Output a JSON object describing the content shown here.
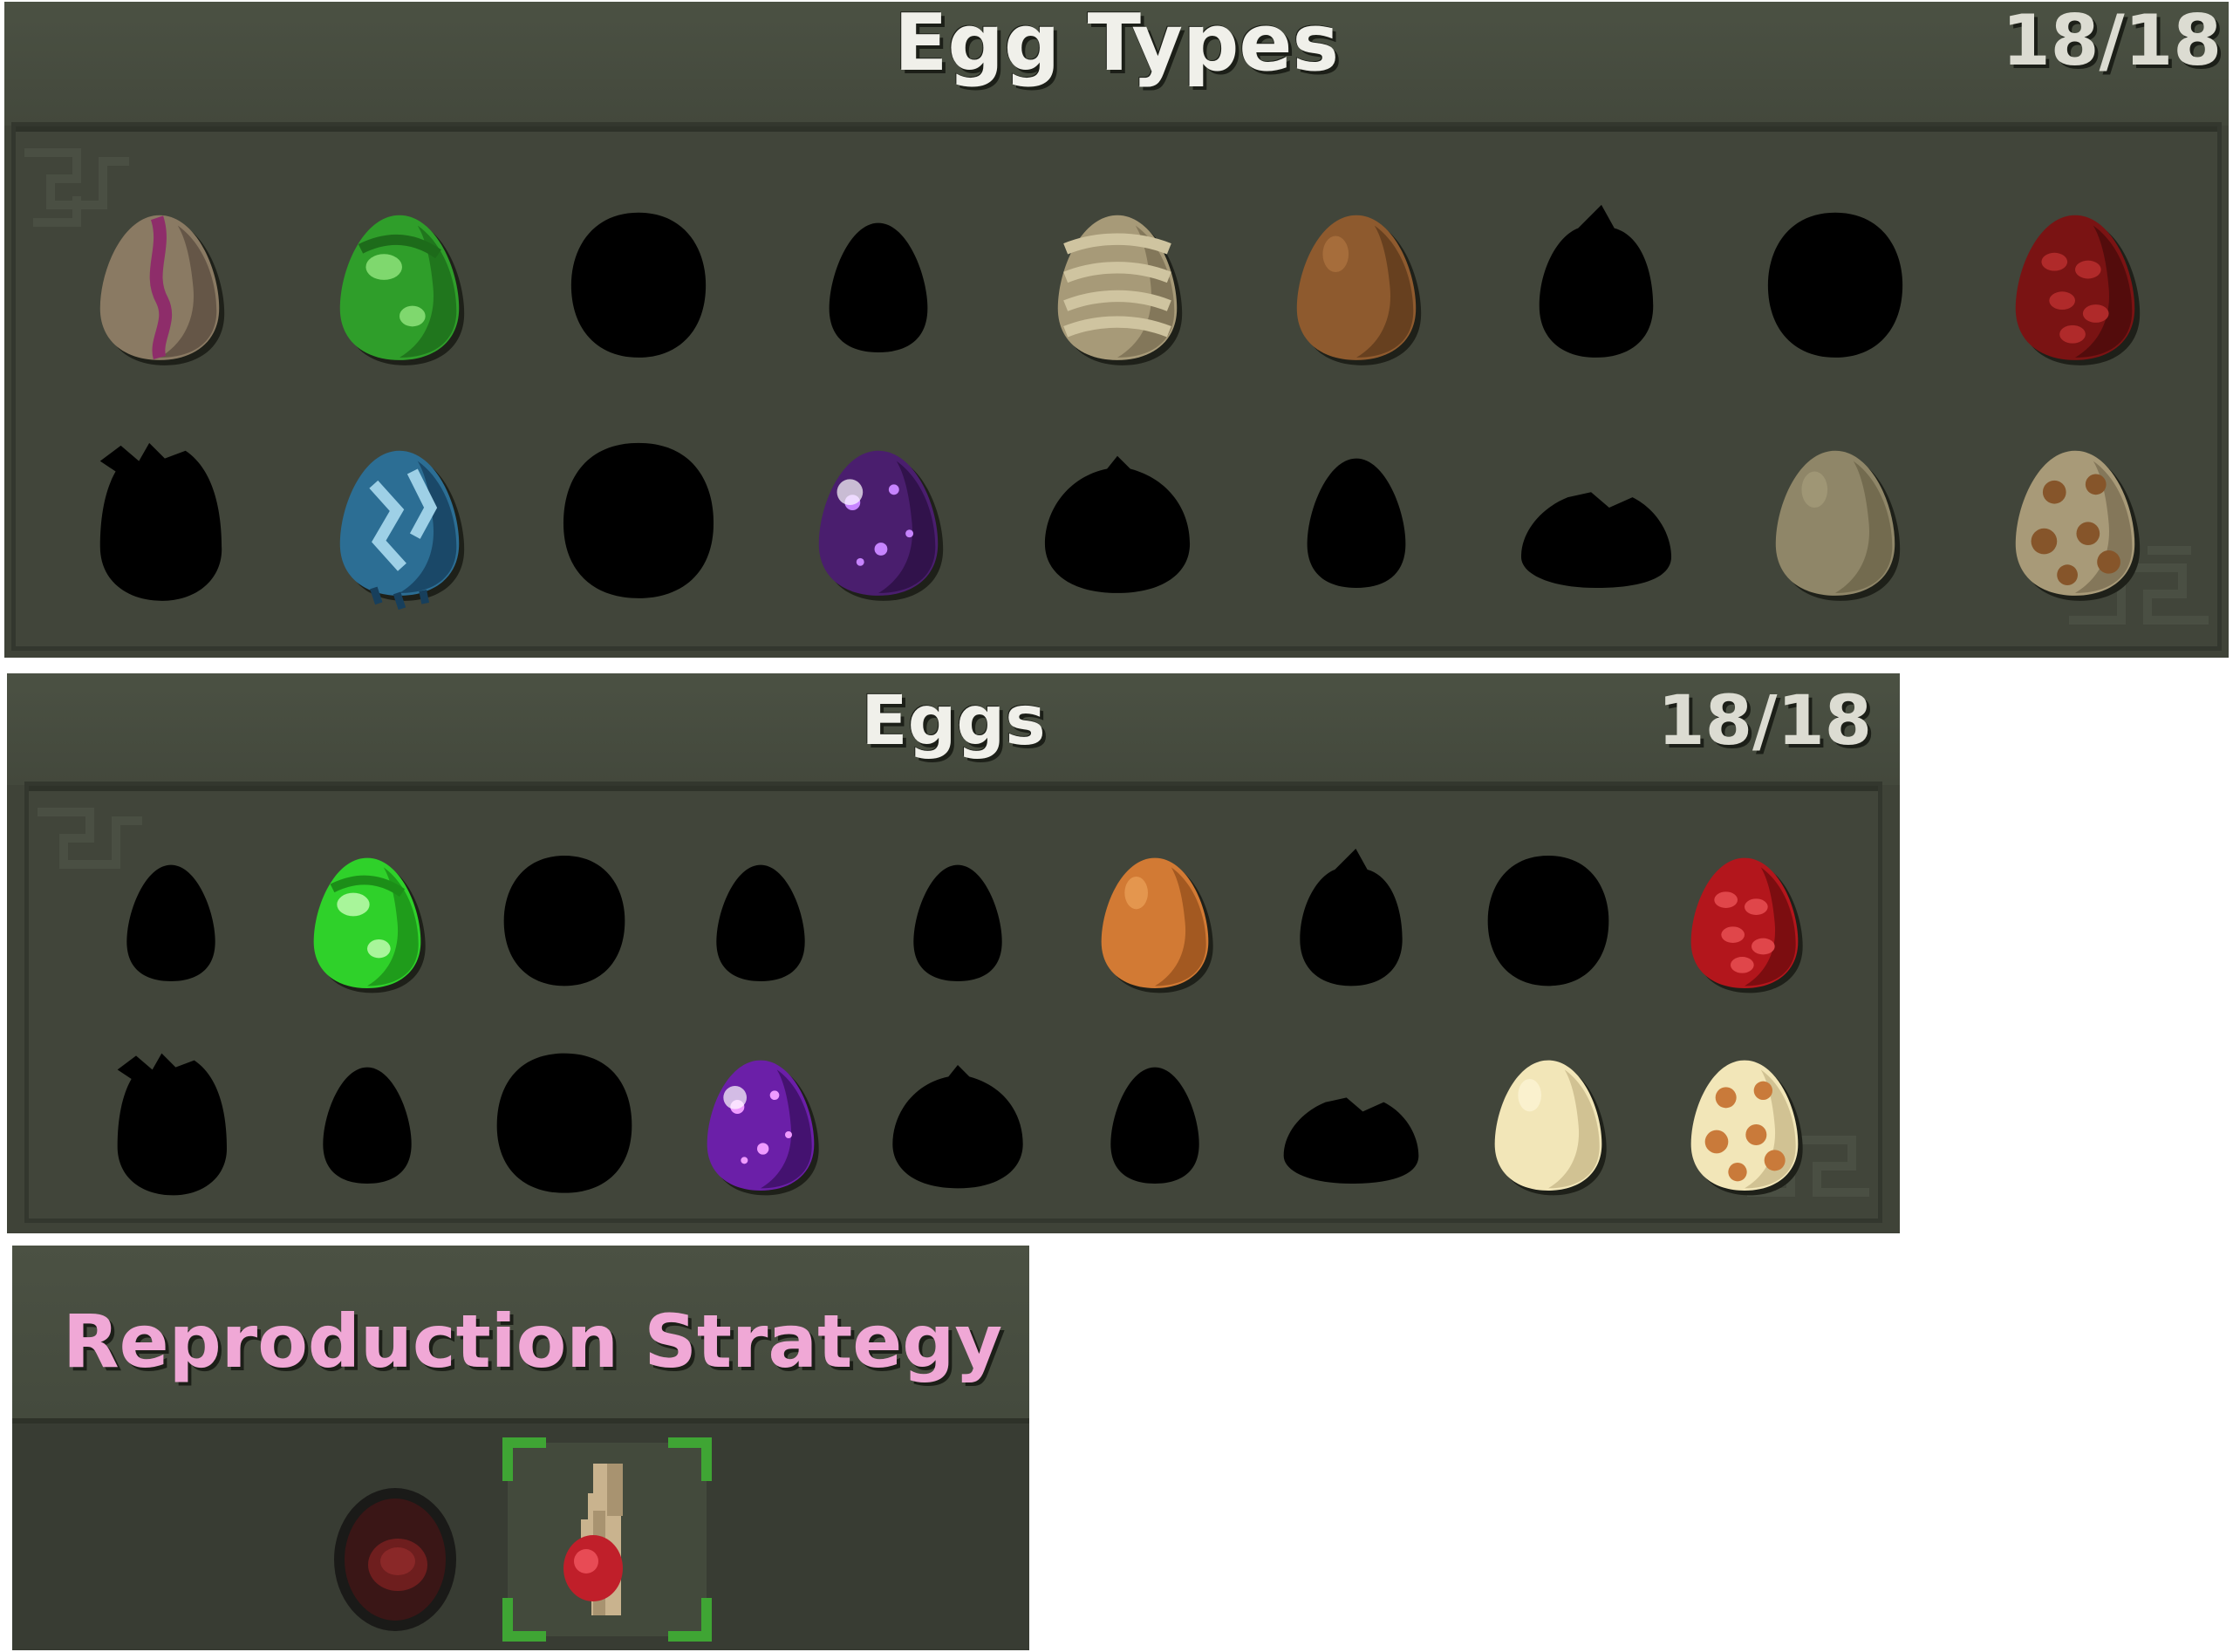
{
  "egg_types": {
    "title": "Egg Types",
    "count": "18/18",
    "rows": [
      [
        {
          "name": "purple-vein-egg",
          "base": "#8a7a63",
          "shade": "#5b4e40",
          "accent": "#8e2d6a",
          "pattern": "vein"
        },
        {
          "name": "green-slime-egg",
          "base": "#2f9e2a",
          "shade": "#1d6b1a",
          "accent": "#7fd86e",
          "pattern": "drip"
        },
        {
          "name": "unknown-egg-round",
          "base": "#000000",
          "shape": "round"
        },
        {
          "name": "unknown-egg-small",
          "base": "#000000",
          "shape": "small"
        },
        {
          "name": "tan-striped-egg",
          "base": "#a79a78",
          "shade": "#7a6e52",
          "accent": "#cfc4a0",
          "pattern": "stripes"
        },
        {
          "name": "brown-egg",
          "base": "#8e5a2e",
          "shade": "#5e3a1c",
          "accent": "#b57a44",
          "pattern": "plain"
        },
        {
          "name": "unknown-egg-horned",
          "base": "#000000",
          "shape": "horned"
        },
        {
          "name": "unknown-egg-round-2",
          "base": "#000000",
          "shape": "round"
        },
        {
          "name": "red-scaled-egg",
          "base": "#7a1313",
          "shade": "#4a0b0b",
          "accent": "#b02a2a",
          "pattern": "scales"
        }
      ],
      [
        {
          "name": "unknown-egg-spiky",
          "base": "#000000",
          "shape": "spiky"
        },
        {
          "name": "blue-crystal-egg",
          "base": "#2c6e94",
          "shade": "#173f5c",
          "accent": "#9ed0e6",
          "pattern": "crystal"
        },
        {
          "name": "unknown-egg-big",
          "base": "#000000",
          "shape": "big"
        },
        {
          "name": "purple-cosmic-egg",
          "base": "#4a1e6e",
          "shade": "#2a0f42",
          "accent": "#c784ff",
          "pattern": "cosmic"
        },
        {
          "name": "unknown-egg-wide",
          "base": "#000000",
          "shape": "wide"
        },
        {
          "name": "unknown-egg-small-2",
          "base": "#000000",
          "shape": "small"
        },
        {
          "name": "unknown-egg-flat",
          "base": "#000000",
          "shape": "flat"
        },
        {
          "name": "beige-plain-egg",
          "base": "#8f8668",
          "shade": "#6c6448",
          "accent": "#aaa27f",
          "pattern": "plain"
        },
        {
          "name": "beige-spotted-egg",
          "base": "#a89a78",
          "shade": "#7a6e52",
          "accent": "#86552a",
          "pattern": "spots"
        }
      ]
    ]
  },
  "eggs": {
    "title": "Eggs",
    "count": "18/18",
    "rows": [
      [
        {
          "name": "unknown-egg",
          "base": "#000000",
          "shape": "small"
        },
        {
          "name": "green-slime-egg",
          "base": "#2fd12a",
          "shade": "#1c8e18",
          "accent": "#a8f59a",
          "pattern": "drip"
        },
        {
          "name": "unknown-egg-round",
          "base": "#000000",
          "shape": "round"
        },
        {
          "name": "unknown-egg-small",
          "base": "#000000",
          "shape": "small"
        },
        {
          "name": "unknown-egg-small-2",
          "base": "#000000",
          "shape": "small"
        },
        {
          "name": "orange-egg",
          "base": "#d27a34",
          "shade": "#97511d",
          "accent": "#f0a860",
          "pattern": "plain"
        },
        {
          "name": "unknown-egg-horned",
          "base": "#000000",
          "shape": "horned"
        },
        {
          "name": "unknown-egg-round-2",
          "base": "#000000",
          "shape": "round"
        },
        {
          "name": "red-scaled-egg",
          "base": "#b3161c",
          "shade": "#6e0b0e",
          "accent": "#e0464a",
          "pattern": "scales"
        }
      ],
      [
        {
          "name": "unknown-egg-spiky",
          "base": "#000000",
          "shape": "spiky"
        },
        {
          "name": "unknown-egg-drip",
          "base": "#000000",
          "shape": "small"
        },
        {
          "name": "unknown-egg-big",
          "base": "#000000",
          "shape": "big"
        },
        {
          "name": "purple-cosmic-egg",
          "base": "#6b1fa8",
          "shade": "#3b0f62",
          "accent": "#ef9bff",
          "pattern": "cosmic"
        },
        {
          "name": "unknown-egg-wide",
          "base": "#000000",
          "shape": "wide"
        },
        {
          "name": "unknown-egg-small-3",
          "base": "#000000",
          "shape": "small"
        },
        {
          "name": "unknown-egg-flat",
          "base": "#000000",
          "shape": "flat"
        },
        {
          "name": "cream-egg",
          "base": "#f2e6b8",
          "shade": "#c8b98a",
          "accent": "#fff8dc",
          "pattern": "plain"
        },
        {
          "name": "cream-spotted-egg",
          "base": "#f2e6b8",
          "shade": "#c8b98a",
          "accent": "#c97a3a",
          "pattern": "spots"
        }
      ]
    ]
  },
  "reproduction": {
    "title": "Reproduction Strategy",
    "title_color": "#f0a8d6",
    "options": [
      {
        "name": "egg-laying-option",
        "icon": "dark-egg-icon",
        "selected": false
      },
      {
        "name": "live-birth-option",
        "icon": "pregnant-figure-icon",
        "selected": true
      }
    ],
    "selection_color": "#3fa534"
  }
}
